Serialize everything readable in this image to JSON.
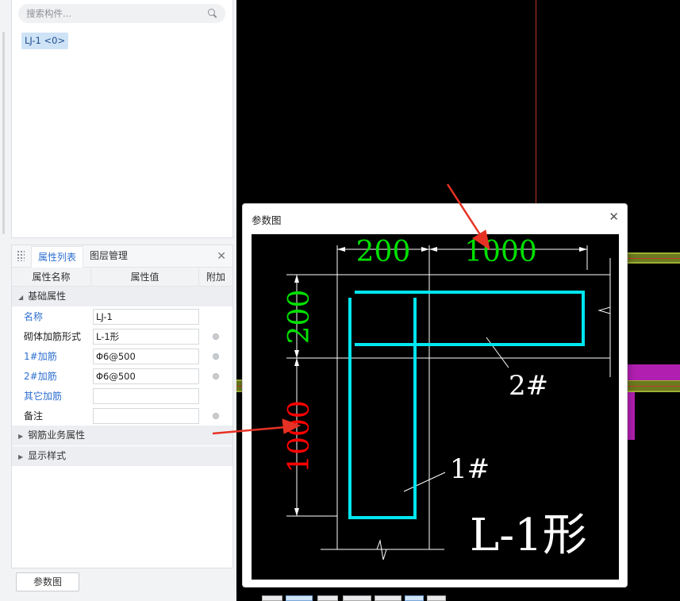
{
  "search": {
    "placeholder": "搜索构件..."
  },
  "component_list": {
    "items": [
      "LJ-1 <0>"
    ]
  },
  "prop_panel": {
    "tabs": [
      "属性列表",
      "图层管理"
    ],
    "columns": [
      "属性名称",
      "属性值",
      "附加"
    ],
    "groups": {
      "basic": "基础属性",
      "rebar": "钢筋业务属性",
      "display": "显示样式"
    },
    "rows": [
      {
        "name": "名称",
        "value": "LJ-1"
      },
      {
        "name": "砌体加筋形式",
        "value": "L-1形"
      },
      {
        "name": "1#加筋",
        "value": "Φ6@500"
      },
      {
        "name": "2#加筋",
        "value": "Φ6@500"
      },
      {
        "name": "其它加筋",
        "value": ""
      },
      {
        "name": "备注",
        "value": ""
      }
    ]
  },
  "bottom_button": "参数图",
  "dialog": {
    "title": "参数图",
    "drawing": {
      "dim_top_left": "200",
      "dim_top_right": "1000",
      "dim_left_top": "200",
      "dim_left_bottom": "1000",
      "label_2": "2#",
      "label_1": "1#",
      "shape_name": "L-1形"
    }
  },
  "colors": {
    "accent": "#2e6fd0",
    "rebar": "#00e5ee",
    "dim_green": "#00e000",
    "dim_red": "#ff0000",
    "arrow": "#e63224"
  }
}
